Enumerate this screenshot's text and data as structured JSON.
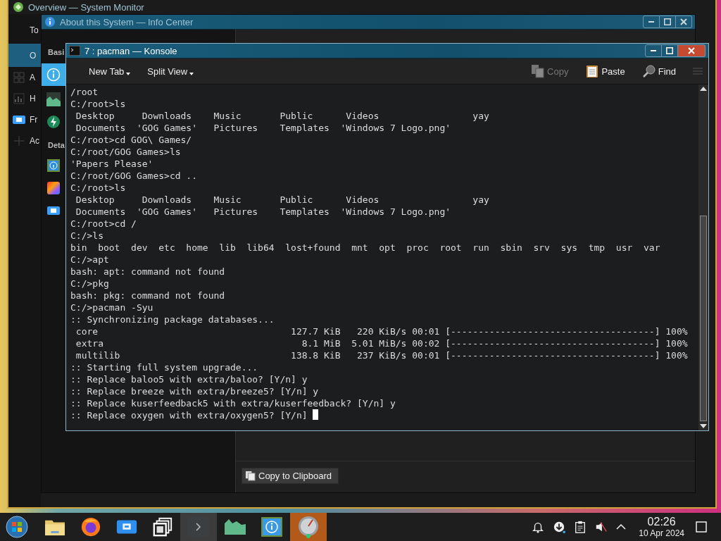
{
  "system_monitor": {
    "title": "Overview — System Monitor",
    "toolbar_label": "To",
    "sidebar": [
      {
        "label": "O",
        "selected": true
      },
      {
        "label": "A",
        "selected": false
      },
      {
        "label": "H",
        "selected": false
      },
      {
        "label": "Fr",
        "selected": false
      },
      {
        "label": "Ac",
        "selected": false
      }
    ]
  },
  "info_center": {
    "title": "About this System — Info Center",
    "sections": [
      {
        "label": "Basi",
        "items": [
          {
            "selected": true
          },
          {
            "selected": false
          },
          {
            "selected": false
          }
        ]
      },
      {
        "label": "Deta",
        "items": [
          {
            "selected": false
          },
          {
            "selected": false
          },
          {
            "selected": false
          }
        ]
      }
    ],
    "copy_button": "Copy to Clipboard"
  },
  "konsole": {
    "title": "7 : pacman — Konsole",
    "tab_buttons": [
      {
        "label": "New Tab",
        "dropdown": true
      },
      {
        "label": "Split View",
        "dropdown": true
      }
    ],
    "actions": [
      {
        "label": "Copy",
        "disabled": true
      },
      {
        "label": "Paste",
        "disabled": false
      },
      {
        "label": "Find",
        "disabled": false
      }
    ],
    "lines": [
      "/root",
      "C:/root>ls",
      " Desktop     Downloads    Music       Public      Videos                 yay",
      " Documents  'GOG Games'   Pictures    Templates  'Windows 7 Logo.png'",
      "C:/root>cd GOG\\ Games/",
      "C:/root/GOG Games>ls",
      "'Papers Please'",
      "C:/root/GOG Games>cd ..",
      "C:/root>ls",
      " Desktop     Downloads    Music       Public      Videos                 yay",
      " Documents  'GOG Games'   Pictures    Templates  'Windows 7 Logo.png'",
      "C:/root>cd /",
      "C:/>ls",
      "bin  boot  dev  etc  home  lib  lib64  lost+found  mnt  opt  proc  root  run  sbin  srv  sys  tmp  usr  var",
      "C:/>apt",
      "bash: apt: command not found",
      "C:/>pkg",
      "bash: pkg: command not found",
      "C:/>pacman -Syu",
      ":: Synchronizing package databases...",
      " core                                   127.7 KiB   220 KiB/s 00:01 [-------------------------------------] 100%",
      " extra                                    8.1 MiB  5.01 MiB/s 00:02 [-------------------------------------] 100%",
      " multilib                               138.8 KiB   237 KiB/s 00:01 [-------------------------------------] 100%",
      ":: Starting full system upgrade...",
      ":: Replace baloo5 with extra/baloo? [Y/n] y",
      ":: Replace breeze with extra/breeze5? [Y/n] y",
      ":: Replace kuserfeedback5 with extra/kuserfeedback? [Y/n] y",
      ":: Replace oxygen with extra/oxygen5? [Y/n] "
    ],
    "cursor": true
  },
  "taskbar": {
    "tasks": [
      {
        "active": true,
        "attention": false
      },
      {
        "active": false,
        "attention": false
      },
      {
        "active": false,
        "attention": false
      },
      {
        "active": false,
        "attention": true
      }
    ],
    "clock": {
      "time": "02:26",
      "date": "10 Apr 2024"
    }
  }
}
